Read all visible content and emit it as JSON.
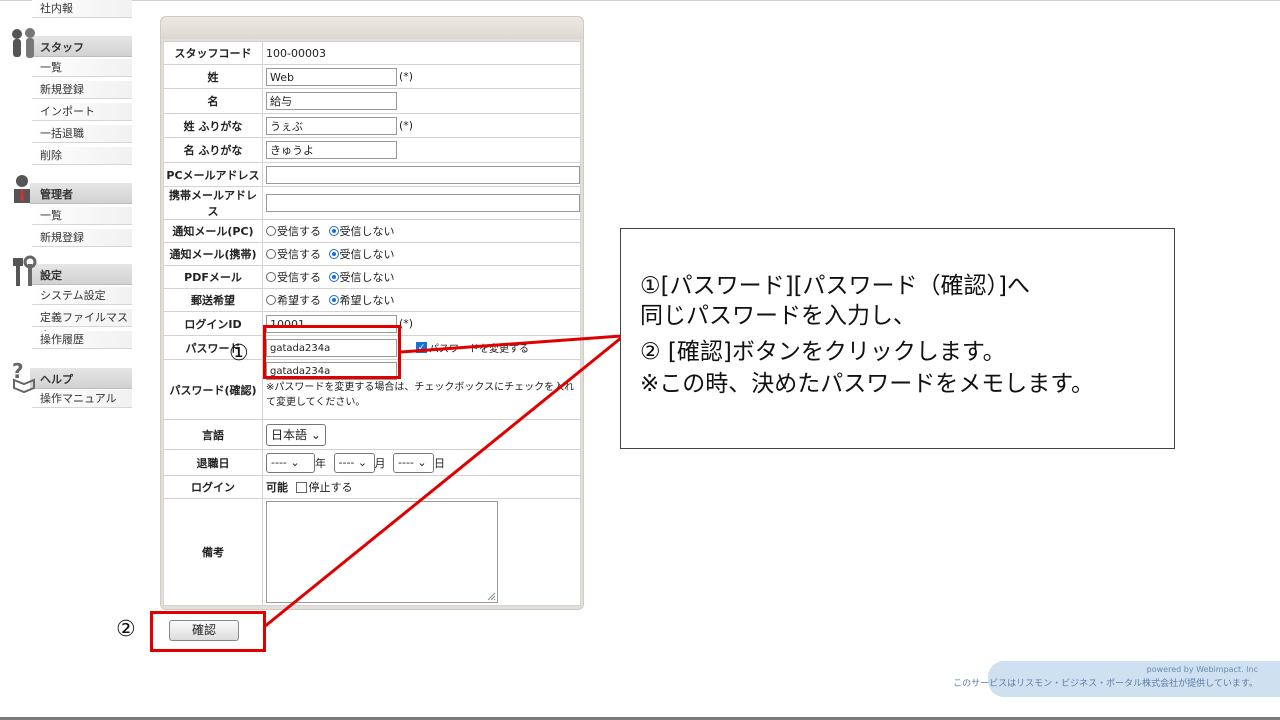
{
  "sidebar": {
    "top_item": "社内報",
    "sections": [
      {
        "title": "スタッフ",
        "icon": "staff-icon",
        "items": [
          "一覧",
          "新規登録",
          "インポート",
          "一括退職",
          "削除"
        ]
      },
      {
        "title": "管理者",
        "icon": "admin-icon",
        "items": [
          "一覧",
          "新規登録"
        ]
      },
      {
        "title": "設定",
        "icon": "settings-icon",
        "items": [
          "システム設定",
          "定義ファイルマスタ",
          "操作履歴"
        ]
      },
      {
        "title": "ヘルプ",
        "icon": "help-icon",
        "items": [
          "操作マニュアル"
        ]
      }
    ]
  },
  "form": {
    "staff_code": {
      "label": "スタッフコード",
      "value": "100-00003"
    },
    "last_name": {
      "label": "姓",
      "value": "Web",
      "required": "(*)"
    },
    "first_name": {
      "label": "名",
      "value": "給与"
    },
    "last_kana": {
      "label": "姓 ふりがな",
      "value": "うぇぶ",
      "required": "(*)"
    },
    "first_kana": {
      "label": "名 ふりがな",
      "value": "きゅうよ"
    },
    "pc_mail": {
      "label": "PCメールアドレス",
      "value": ""
    },
    "mobile_mail": {
      "label": "携帯メールアドレス",
      "value": ""
    },
    "notify_pc": {
      "label": "通知メール(PC)",
      "opt1": "受信する",
      "opt2": "受信しない",
      "selected": "受信しない"
    },
    "notify_mobile": {
      "label": "通知メール(携帯)",
      "opt1": "受信する",
      "opt2": "受信しない",
      "selected": "受信しない"
    },
    "pdf_mail": {
      "label": "PDFメール",
      "opt1": "受信する",
      "opt2": "受信しない",
      "selected": "受信しない"
    },
    "postal": {
      "label": "郵送希望",
      "opt1": "希望する",
      "opt2": "希望しない",
      "selected": "希望しない"
    },
    "login_id": {
      "label": "ログインID",
      "value": "10001",
      "required": "(*)"
    },
    "password": {
      "label": "パスワード",
      "value": "gatada234a",
      "change_label": "パスワードを変更する",
      "change_checked": true
    },
    "password_confirm": {
      "label": "パスワード(確認)",
      "value": "gatada234a",
      "note": "※パスワードを変更する場合は、チェックボックスにチェックを入れて変更してください。"
    },
    "language": {
      "label": "言語",
      "value": "日本語"
    },
    "retire_date": {
      "label": "退職日",
      "year": "----",
      "month": "----",
      "day": "----",
      "year_unit": "年",
      "month_unit": "月",
      "day_unit": "日"
    },
    "login": {
      "label": "ログイン",
      "status": "可能",
      "stop_label": "停止する"
    },
    "remarks": {
      "label": "備考",
      "value": ""
    }
  },
  "confirm_button": "確認",
  "annotations": {
    "mark1": "①",
    "mark2": "②",
    "callout_lines": [
      "①[パスワード][パスワード（確認）]へ",
      "同じパスワードを入力し、",
      "② [確認]ボタンをクリックします。",
      "※この時、決めたパスワードをメモします。"
    ],
    "highlight_color": "#e00000"
  },
  "footer": {
    "powered": "powered by Webimpact. Inc",
    "service": "このサービスはリスモン・ビジネス・ポータル株式会社が提供しています。"
  }
}
